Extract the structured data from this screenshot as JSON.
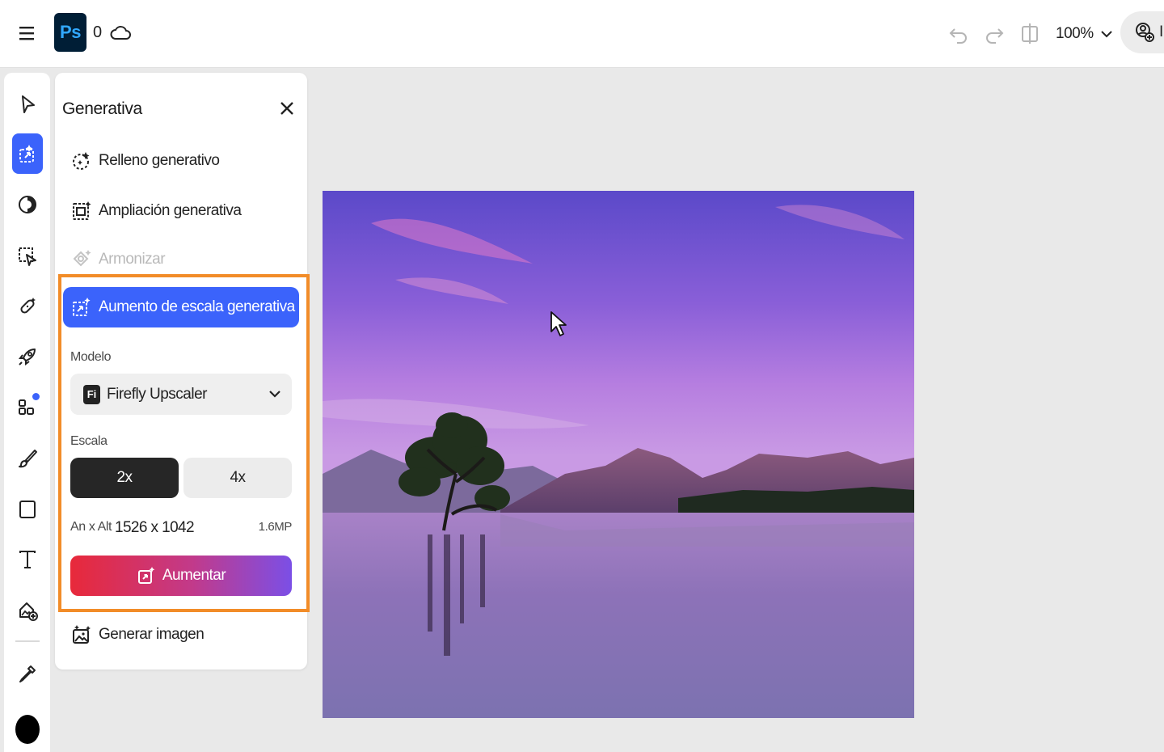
{
  "app": {
    "logo_text": "Ps",
    "cloud_count": "0"
  },
  "header": {
    "zoom_value": "100%",
    "share_label": "In"
  },
  "panel": {
    "title": "Generativa",
    "items": [
      {
        "label": "Relleno generativo",
        "icon": "generative-fill-icon"
      },
      {
        "label": "Ampliación generativa",
        "icon": "generative-expand-icon"
      },
      {
        "label": "Armonizar",
        "icon": "harmonize-icon",
        "disabled": true
      },
      {
        "label": "Aumento de escala generativa",
        "icon": "generative-upscale-icon",
        "selected": true
      },
      {
        "label": "Generar imagen",
        "icon": "generate-image-icon"
      }
    ],
    "model_label": "Modelo",
    "model_badge": "Fi",
    "model_value": "Firefly Upscaler",
    "scale_label": "Escala",
    "scale_options": [
      "2x",
      "4x"
    ],
    "scale_selected": "2x",
    "dims_label": "An x Alt",
    "dims_value": "1526 x 1042",
    "megapixels": "1.6MP",
    "upscale_button": "Aumentar"
  },
  "colors": {
    "accent": "#3b63fb",
    "highlight": "#f28c28",
    "foreground_color": "#000000"
  },
  "toolbar": {
    "tools": [
      "select-icon",
      "generative-icon",
      "adjustments-icon",
      "selection-icon",
      "heal-icon",
      "quick-actions-icon",
      "add-ons-icon",
      "brush-icon",
      "shape-icon",
      "text-icon",
      "add-image-icon",
      "eyedropper-icon"
    ]
  }
}
